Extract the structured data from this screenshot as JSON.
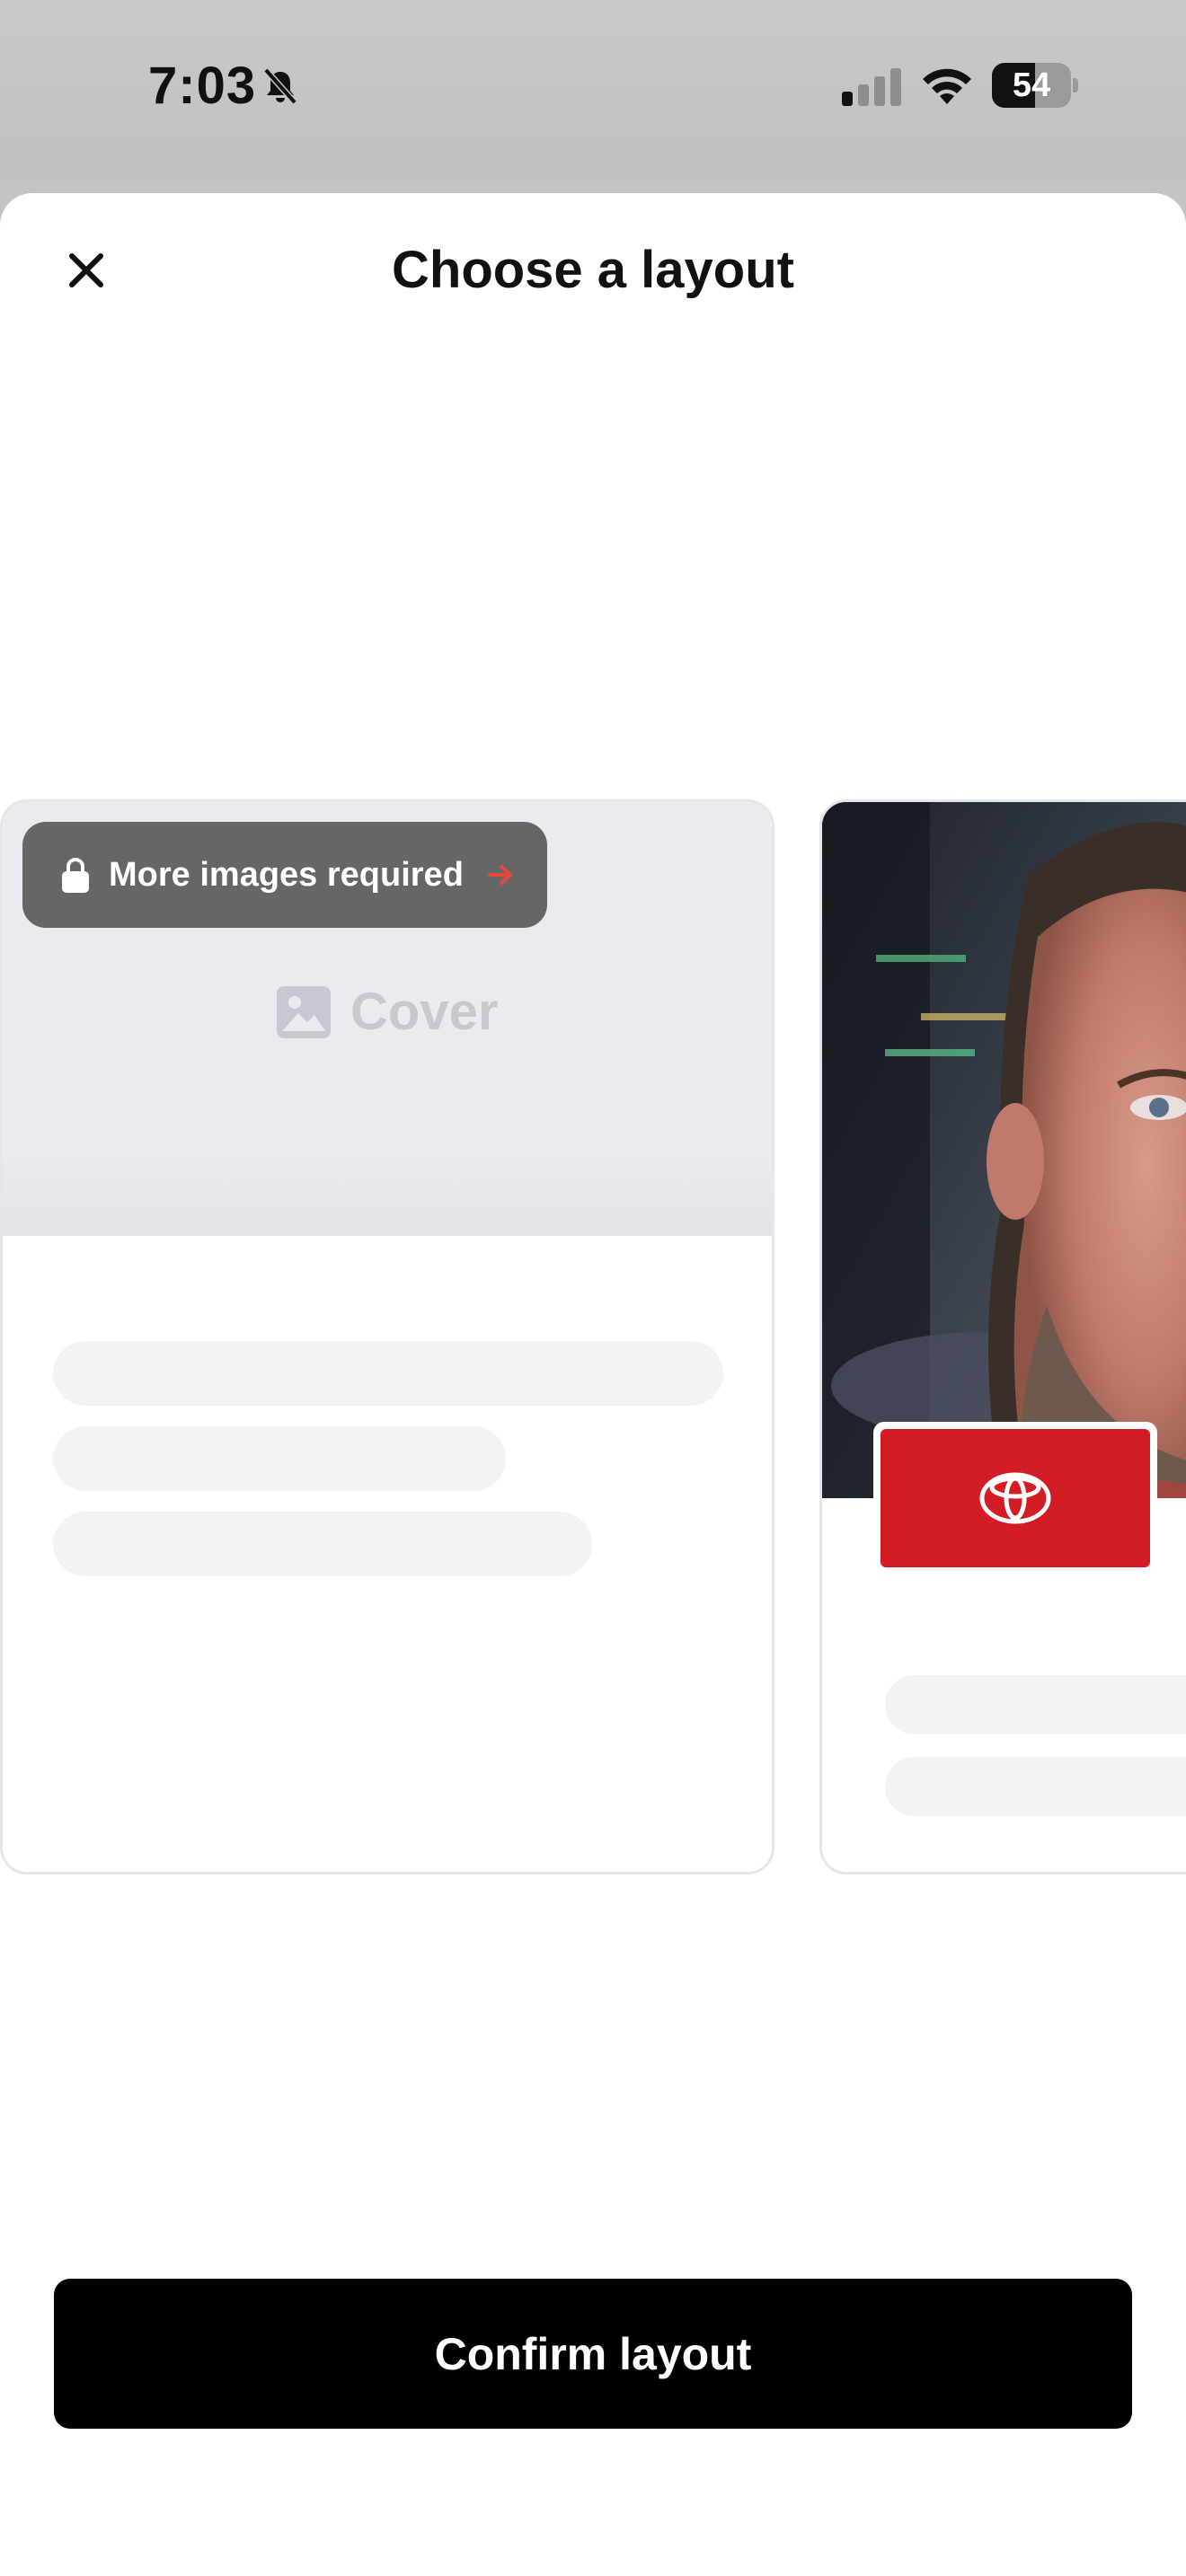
{
  "status_bar": {
    "time": "7:03",
    "battery_percent": "54",
    "battery_level": 54,
    "icons": [
      "bell-slash-icon",
      "cellular-signal-icon",
      "wifi-icon",
      "battery-icon"
    ]
  },
  "sheet": {
    "title": "Choose a layout",
    "close_icon": "close-icon"
  },
  "layouts": [
    {
      "name": "cover",
      "locked_badge": {
        "label": "More images required",
        "icon": "lock-icon",
        "arrow_icon": "arrow-right-icon",
        "arrow_color": "#e8473d"
      },
      "cover_label": "Cover",
      "cover_icon": "image-icon"
    },
    {
      "name": "photo-with-logo",
      "brand_logo": "toyota-logo-icon",
      "brand_color": "#d41c24"
    }
  ],
  "confirm_button": {
    "label": "Confirm layout"
  }
}
